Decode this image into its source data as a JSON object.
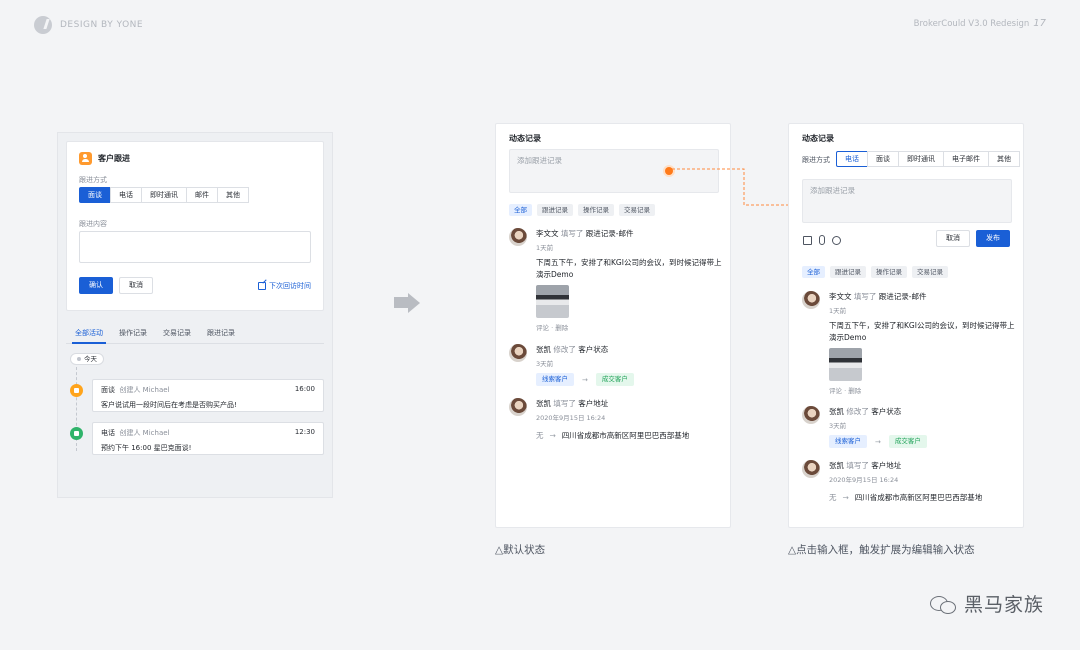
{
  "header": {
    "brand": "DESIGN BY YONE",
    "version": "BrokerCould V3.0 Redesign",
    "page_number": "17"
  },
  "panel1": {
    "form_title": "客户跟进",
    "method_label": "跟进方式",
    "methods": [
      "面谈",
      "电话",
      "即时通讯",
      "邮件",
      "其他"
    ],
    "content_label": "跟进内容",
    "confirm": "确认",
    "cancel": "取消",
    "next_visit": "下次回访时间",
    "tabs": [
      "全部活动",
      "操作记录",
      "交易记录",
      "跟进记录"
    ],
    "today": "今天",
    "activities": [
      {
        "type": "面谈",
        "creator": "创建人  Michael",
        "time": "16:00",
        "text": "客户说试用一段时间后在考虑是否购买产品!",
        "color": "#ffa41b"
      },
      {
        "type": "电话",
        "creator": "创建人  Michael",
        "time": "12:30",
        "text": "预约下午 16:00 星巴克面谈!",
        "color": "#2fb36a"
      }
    ]
  },
  "feed": {
    "title": "动态记录",
    "placeholder": "添加跟进记录",
    "filters": [
      "全部",
      "跟进记录",
      "操作记录",
      "交易记录"
    ],
    "entries": {
      "e1": {
        "name": "李文文",
        "verb": "填写了",
        "obj": "跟进记录-邮件",
        "time": "1天前",
        "text": "下周五下午，安排了和KGI公司的会议，到时候记得带上演示Demo",
        "actions": "评论 · 删除"
      },
      "e2": {
        "name": "张凯",
        "verb": "修改了",
        "obj": "客户状态",
        "time": "3天前",
        "from": "线索客户",
        "to": "成交客户"
      },
      "e3": {
        "name": "张凯",
        "verb": "填写了",
        "obj": "客户地址",
        "time": "2020年9月15日 16:24",
        "from": "无",
        "to": "四川省成都市高新区阿里巴巴西部基地"
      }
    },
    "arrow": "→"
  },
  "panel3": {
    "method_label": "跟进方式",
    "methods": [
      "电话",
      "面谈",
      "即时通讯",
      "电子邮件",
      "其他"
    ],
    "cancel": "取消",
    "publish": "发布"
  },
  "captions": {
    "default": "△默认状态",
    "expanded": "△点击输入框，触发扩展为编辑输入状态"
  },
  "watermark": "黑马家族",
  "colors": {
    "primary": "#1a5fd6",
    "accent": "#ff7a1a"
  }
}
